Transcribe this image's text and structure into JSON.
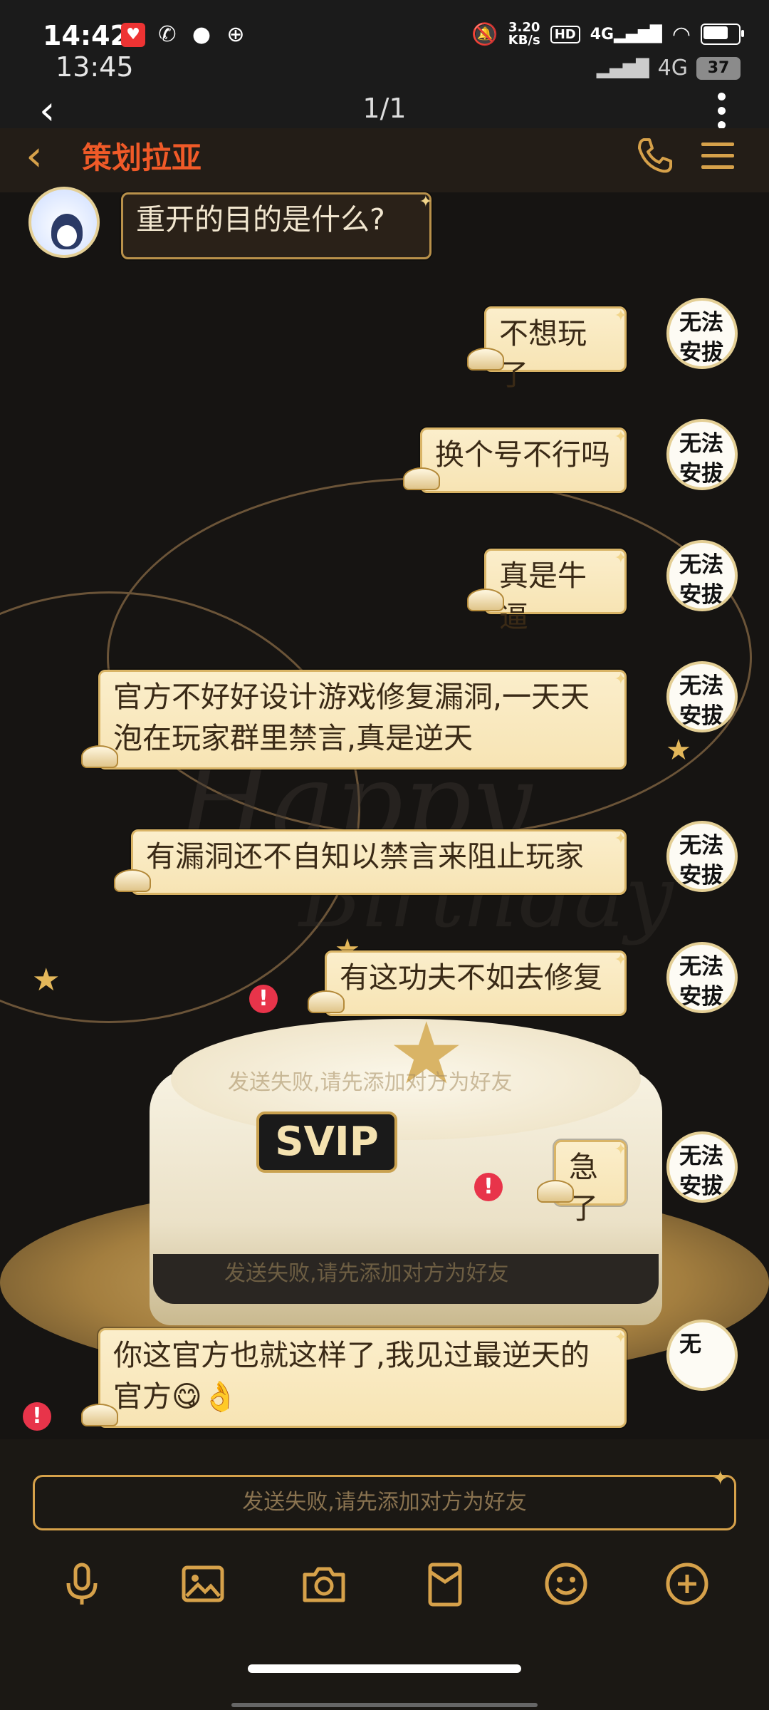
{
  "status_bar": {
    "time_top": "14:42",
    "time_bottom": "13:45",
    "net_speed_top": "3.20",
    "net_speed_bottom": "KB/s",
    "hd_label": "HD",
    "net_label": "4G",
    "net_label_2": "4G",
    "battery_level": 0.78,
    "battery_2": "37"
  },
  "viewer": {
    "page_count": "1/1"
  },
  "header": {
    "title": "策划拉亚"
  },
  "avatar_label": "无法\n安拔",
  "avatar_label_small": "无",
  "messages": [
    {
      "id": "m0",
      "side": "in",
      "text": "重开的目的是什么?"
    },
    {
      "id": "m1",
      "side": "out",
      "text": "不想玩了"
    },
    {
      "id": "m2",
      "side": "out",
      "text": "换个号不行吗"
    },
    {
      "id": "m3",
      "side": "out",
      "text": "真是牛逼"
    },
    {
      "id": "m4",
      "side": "out",
      "text": "官方不好好设计游戏修复漏洞,一天天泡在玩家群里禁言,真是逆天"
    },
    {
      "id": "m5",
      "side": "out",
      "text": "有漏洞还不自知以禁言来阻止玩家"
    },
    {
      "id": "m6",
      "side": "out",
      "text": "有这功夫不如去修复"
    },
    {
      "id": "m7",
      "side": "out",
      "text": "急了"
    },
    {
      "id": "m8",
      "side": "out",
      "text": "你这官方也就这样了,我见过最逆天的官方😋👌"
    }
  ],
  "failure_notice": "发送失败,请先添加对方为好友",
  "input_placeholder": "发送失败,请先添加对方为好友",
  "decor": {
    "svip_label": "SVIP",
    "bday_1": "Happy",
    "bday_2": "Birthday"
  },
  "toolbar": {
    "icons": [
      "microphone-icon",
      "image-icon",
      "camera-icon",
      "red-packet-icon",
      "emoji-icon",
      "plus-icon"
    ]
  },
  "colors": {
    "accent_gold": "#d6a14a",
    "title_red": "#f05a28",
    "bubble_fill": "#f7e4b4",
    "error_red": "#e8344a"
  }
}
